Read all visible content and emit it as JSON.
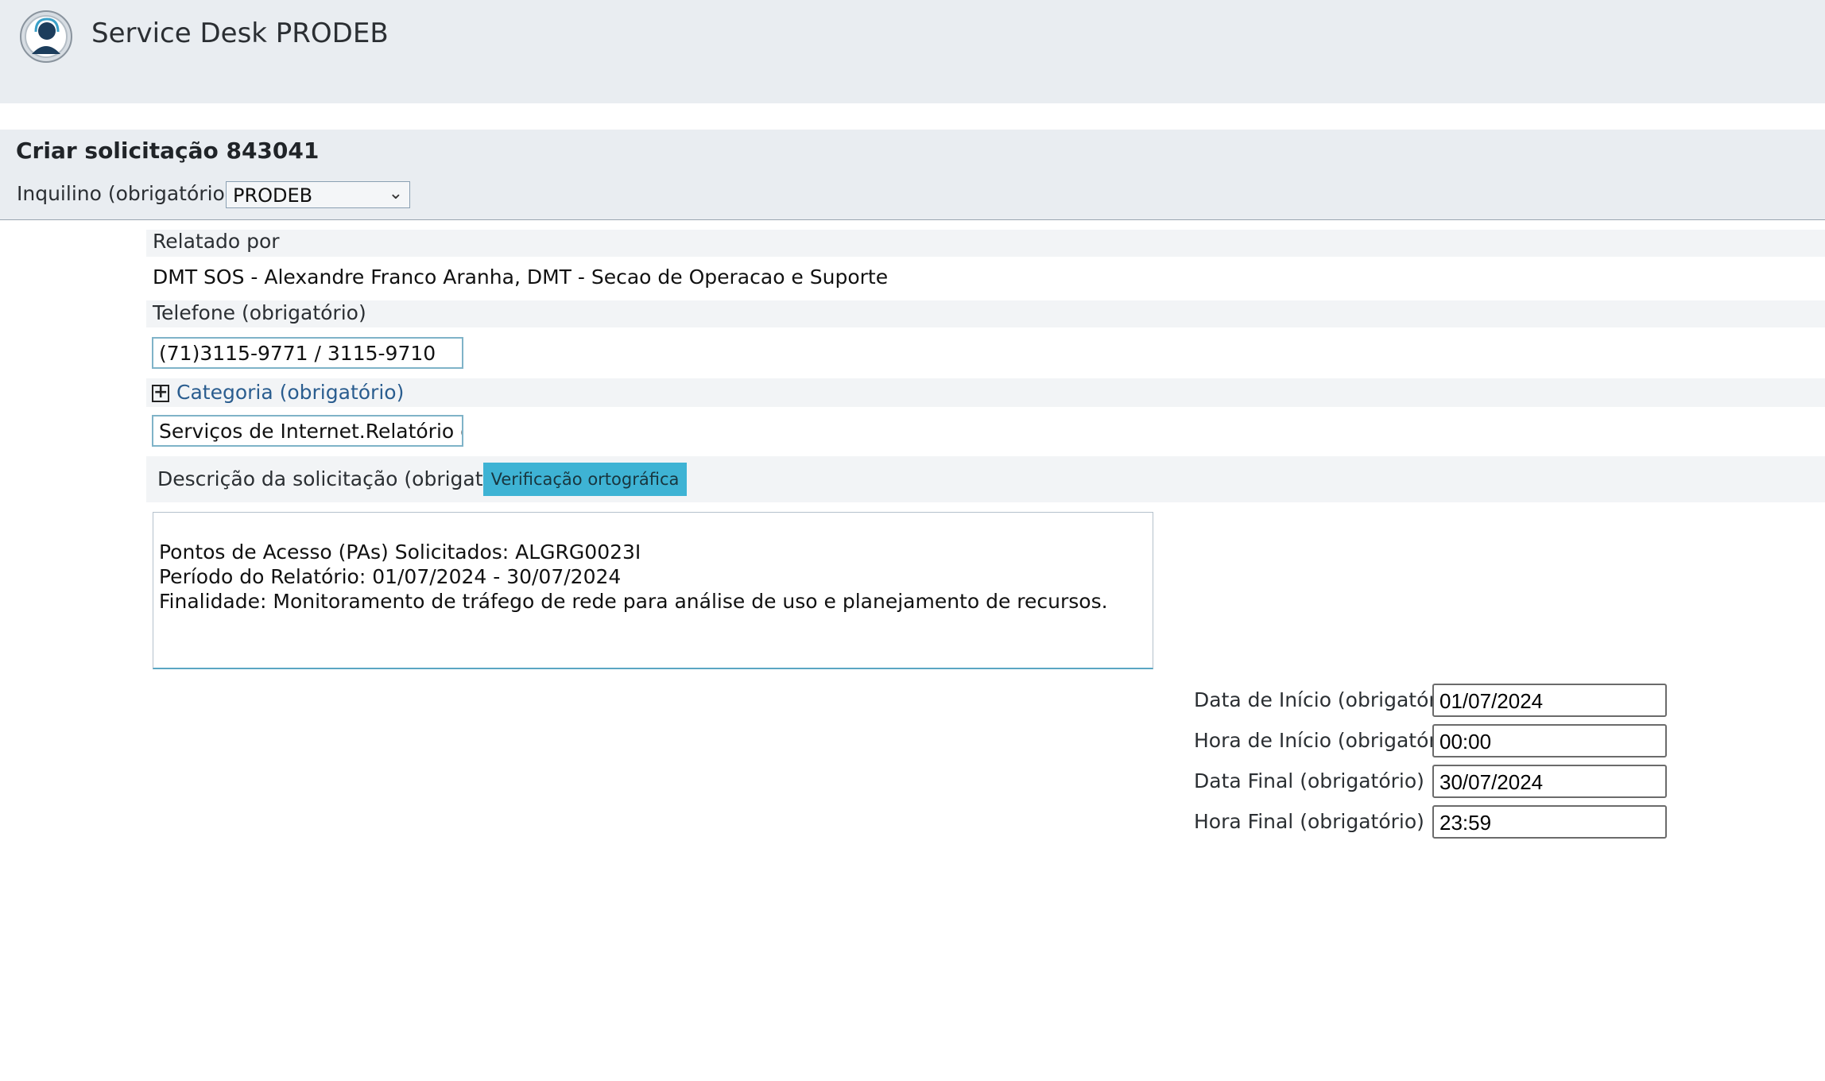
{
  "header": {
    "app_title": "Service Desk PRODEB",
    "logo_icon": "headset-agent-icon"
  },
  "form": {
    "title": "Criar solicitação 843041",
    "tenant_label": "Inquilino (obrigatório)",
    "tenant_value": "PRODEB",
    "reported_by_label": "Relatado por",
    "reported_by_value": "DMT SOS - Alexandre Franco Aranha, DMT - Secao de Operacao e Suporte",
    "phone_label": "Telefone (obrigatório)",
    "phone_value": "(71)3115-9771 / 3115-9710",
    "category_label": "Categoria (obrigatório)",
    "category_value": "Serviços de Internet.Relatório de Tr",
    "description_label": "Descrição da solicitação (obrigatório)",
    "spell_check_label": "Verificação ortográfica",
    "description_lines": [
      "Pontos de Acesso (PAs) Solicitados: ALGRG0023I",
      "Período do Relatório: 01/07/2024 - 30/07/2024",
      "Finalidade: Monitoramento de tráfego de rede para análise de uso e planejamento de recursos."
    ],
    "start_date_label": "Data de Início (obrigatório)",
    "start_date_value": "01/07/2024",
    "start_time_label": "Hora de Início (obrigatório)",
    "start_time_value": "00:00",
    "end_date_label": "Data Final (obrigatório)",
    "end_date_value": "30/07/2024",
    "end_time_label": "Hora Final (obrigatório)",
    "end_time_value": "23:59"
  },
  "colors": {
    "header_bg": "#e9edf1",
    "button_bg": "#3eb3d4",
    "link": "#2a5d8f"
  }
}
